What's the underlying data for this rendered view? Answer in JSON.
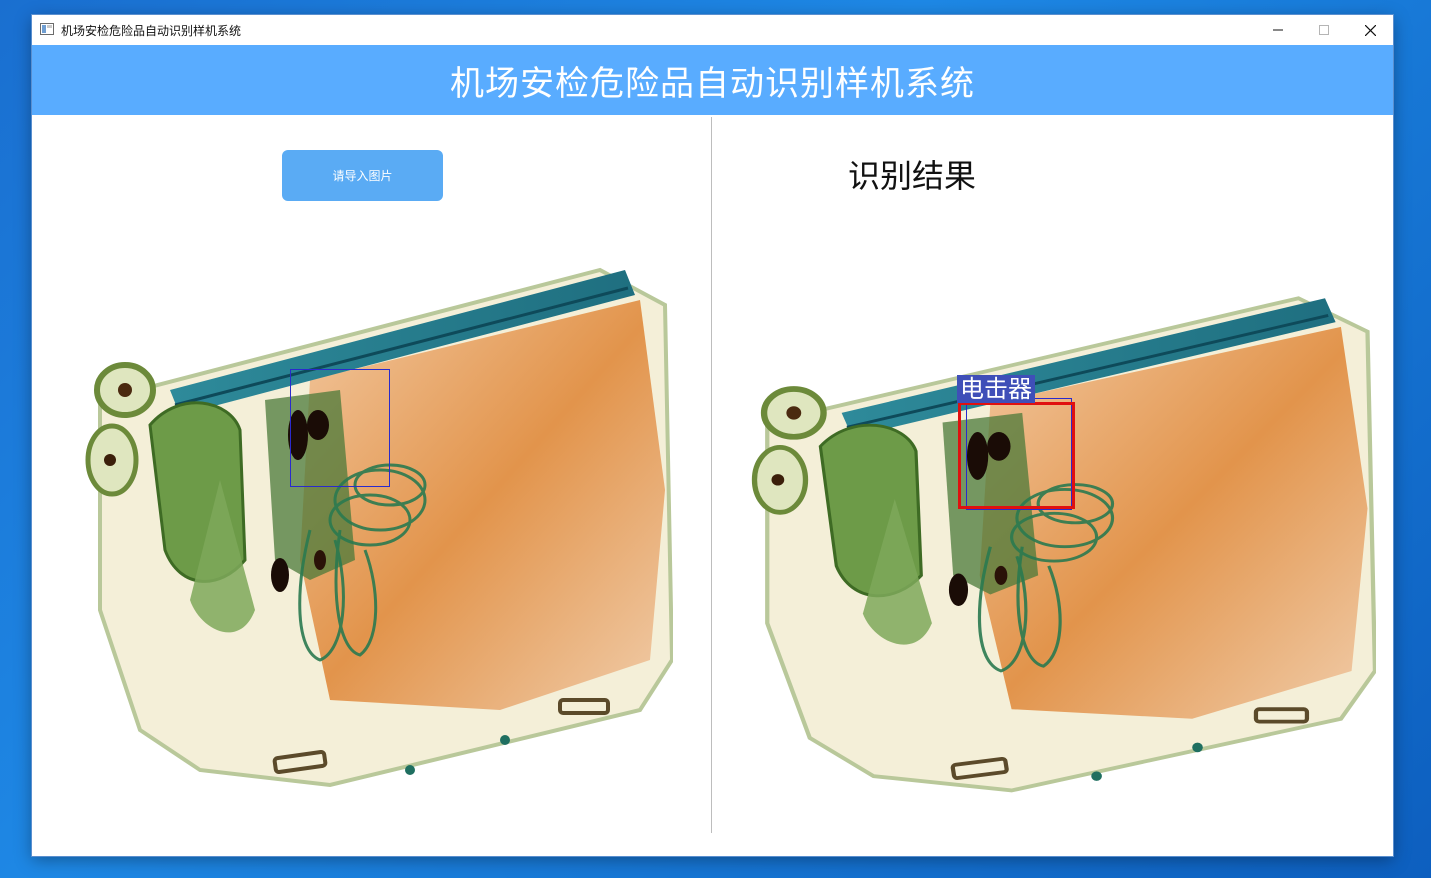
{
  "window": {
    "title": "机场安检危险品自动识别样机系统",
    "controls": {
      "minimize": "minimize-icon",
      "maximize": "maximize-icon",
      "close": "close-icon"
    }
  },
  "header": {
    "title": "机场安检危险品自动识别样机系统",
    "background": "#59acff"
  },
  "left_panel": {
    "import_button": "请导入图片",
    "image_icon": "xray-baggage-image"
  },
  "right_panel": {
    "title": "识别结果",
    "detection": {
      "label": "电击器",
      "box_color": "#e01010",
      "label_bg": "#3f4fb8"
    }
  },
  "colors": {
    "accent": "#59acff",
    "button": "#5aabf4"
  }
}
